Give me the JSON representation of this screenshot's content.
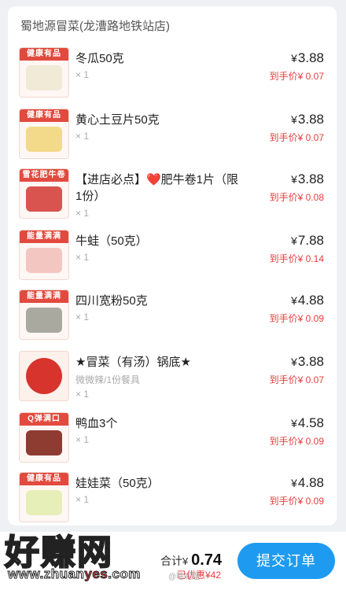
{
  "store_name": "蜀地源冒菜(龙漕路地铁站店)",
  "items": [
    {
      "name": "冬瓜50克",
      "sub": "",
      "qty": "× 1",
      "price": "3.88",
      "final_label": "到手价",
      "final_price": "¥ 0.07",
      "badge": "健康有品",
      "food_color": "#f1ead7"
    },
    {
      "name": "黄心土豆片50克",
      "sub": "",
      "qty": "× 1",
      "price": "3.88",
      "final_label": "到手价",
      "final_price": "¥ 0.07",
      "badge": "健康有品",
      "food_color": "#f3d98a"
    },
    {
      "name": "【进店必点】❤️肥牛卷1片（限1份）",
      "sub": "",
      "qty": "× 1",
      "price": "3.88",
      "final_label": "到手价",
      "final_price": "¥ 0.08",
      "badge": "雪花肥牛卷",
      "food_color": "#d9534f"
    },
    {
      "name": "牛蛙（50克）",
      "sub": "",
      "qty": "× 1",
      "price": "7.88",
      "final_label": "到手价",
      "final_price": "¥ 0.14",
      "badge": "能量满满",
      "food_color": "#f4c6c2"
    },
    {
      "name": "四川宽粉50克",
      "sub": "",
      "qty": "× 1",
      "price": "4.88",
      "final_label": "到手价",
      "final_price": "¥ 0.09",
      "badge": "能量满满",
      "food_color": "#a9a9a0"
    },
    {
      "name": "★冒菜（有汤）锅底★",
      "sub": "微微辣/1份餐具",
      "qty": "× 1",
      "price": "3.88",
      "final_label": "到手价",
      "final_price": "¥ 0.07",
      "badge": "",
      "food_color": "#d6342c"
    },
    {
      "name": "鸭血3个",
      "sub": "",
      "qty": "× 1",
      "price": "4.58",
      "final_label": "到手价",
      "final_price": "¥ 0.09",
      "badge": "Q弹满口",
      "food_color": "#8e3b32"
    },
    {
      "name": "娃娃菜（50克）",
      "sub": "",
      "qty": "× 1",
      "price": "4.88",
      "final_label": "到手价",
      "final_price": "¥ 0.09",
      "badge": "健康有品",
      "food_color": "#e7efb8"
    }
  ],
  "currency": "¥",
  "footer": {
    "total_label": "合计",
    "total_amount": "0.74",
    "saved_text": "已优惠¥42",
    "submit_label": "提交订单"
  },
  "watermark": {
    "big": "好赚网",
    "url_a": "www.zhuan",
    "url_b": "yes",
    "url_c": ".com",
    "weibo": "@啥呢题"
  },
  "colors": {
    "accent": "#1e9bf0",
    "discount": "#e63d3d"
  }
}
